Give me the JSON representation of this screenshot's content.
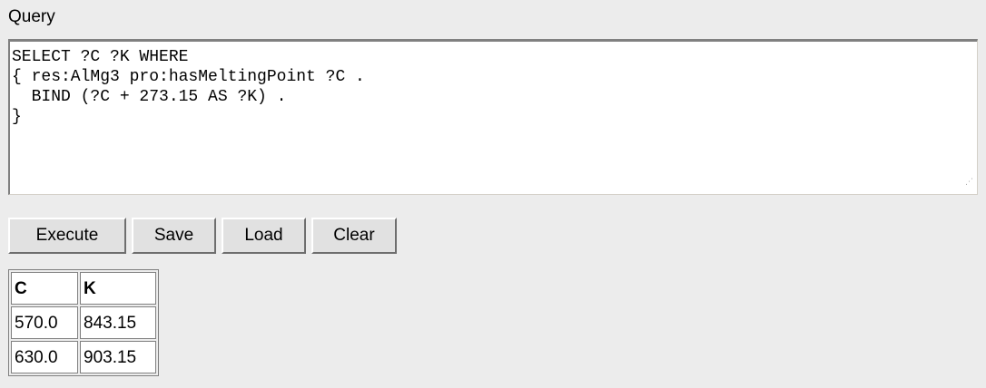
{
  "query_panel": {
    "label": "Query",
    "text": "SELECT ?C ?K WHERE\n{ res:AlMg3 pro:hasMeltingPoint ?C .\n  BIND (?C + 273.15 AS ?K) .\n}"
  },
  "buttons": {
    "execute": "Execute",
    "save": "Save",
    "load": "Load",
    "clear": "Clear"
  },
  "results": {
    "columns": [
      "C",
      "K"
    ],
    "rows": [
      [
        "570.0",
        "843.15"
      ],
      [
        "630.0",
        "903.15"
      ]
    ]
  }
}
